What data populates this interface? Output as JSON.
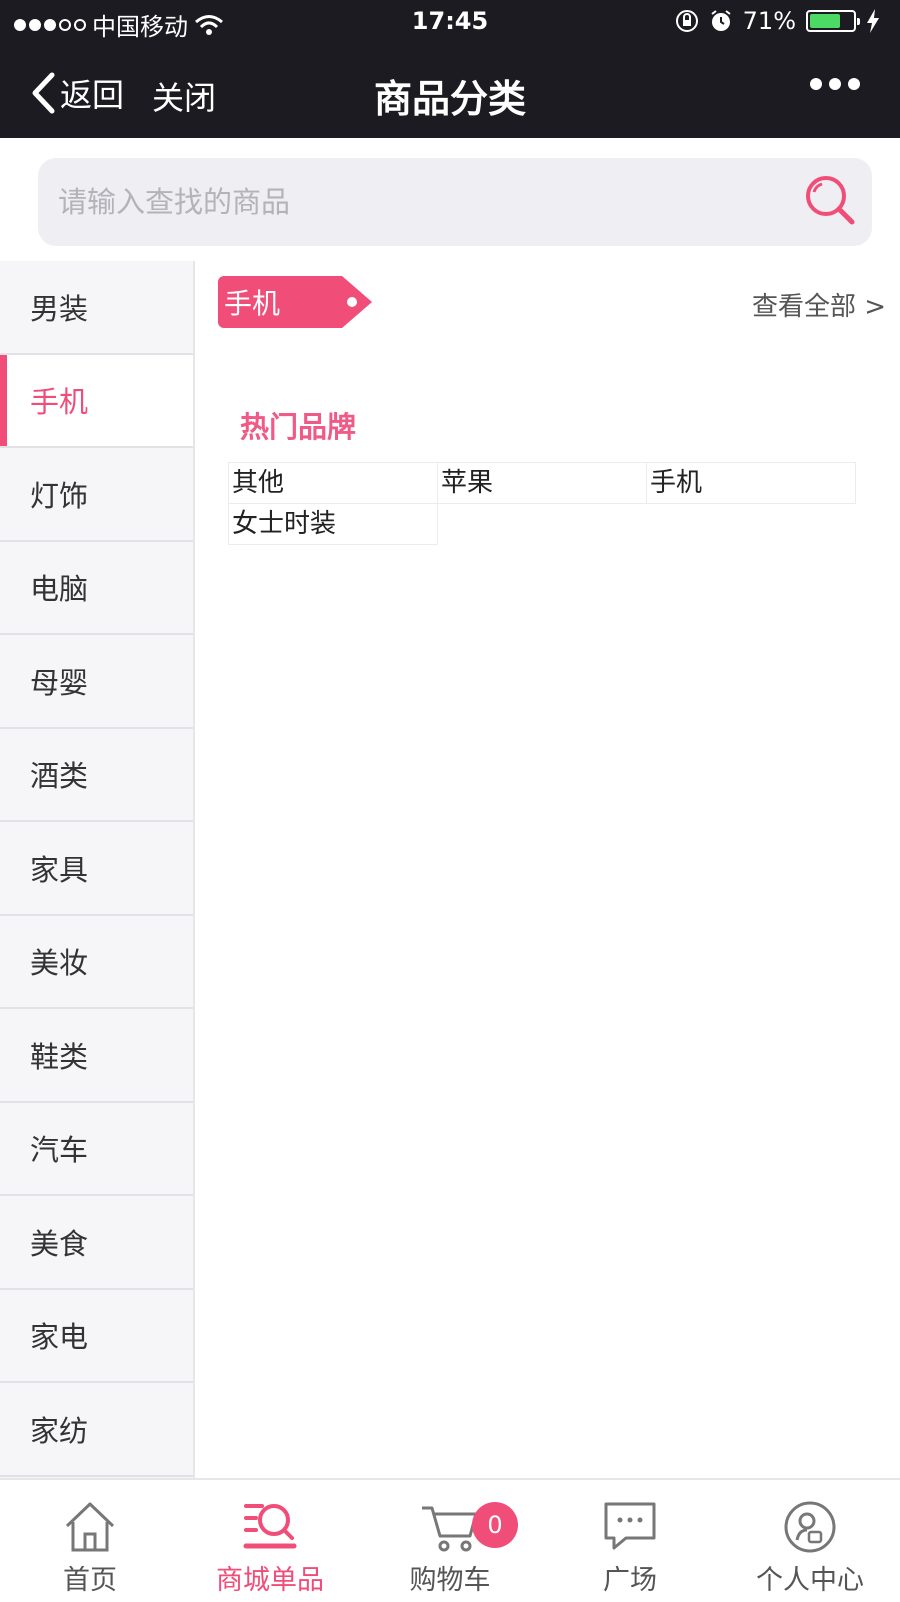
{
  "status_bar": {
    "carrier": "中国移动",
    "time": "17:45",
    "battery": "71%",
    "battery_level": 0.71
  },
  "nav": {
    "back_label": "返回",
    "close_label": "关闭",
    "title": "商品分类"
  },
  "search": {
    "placeholder": "请输入查找的商品",
    "value": ""
  },
  "sidebar": {
    "items": [
      {
        "label": "男装",
        "active": false
      },
      {
        "label": "手机",
        "active": true
      },
      {
        "label": "灯饰",
        "active": false
      },
      {
        "label": "电脑",
        "active": false
      },
      {
        "label": "母婴",
        "active": false
      },
      {
        "label": "酒类",
        "active": false
      },
      {
        "label": "家具",
        "active": false
      },
      {
        "label": "美妆",
        "active": false
      },
      {
        "label": "鞋类",
        "active": false
      },
      {
        "label": "汽车",
        "active": false
      },
      {
        "label": "美食",
        "active": false
      },
      {
        "label": "家电",
        "active": false
      },
      {
        "label": "家纺",
        "active": false
      }
    ]
  },
  "content": {
    "category_tag": "手机",
    "view_all": "查看全部 >",
    "hot_brands_title": "热门品牌",
    "brands": [
      "其他",
      "苹果",
      "手机",
      "女士时装"
    ]
  },
  "tabbar": {
    "tabs": [
      {
        "label": "首页",
        "icon": "home-icon"
      },
      {
        "label": "商城单品",
        "icon": "store-search-icon"
      },
      {
        "label": "购物车",
        "icon": "cart-icon"
      },
      {
        "label": "广场",
        "icon": "chat-bubble-icon"
      },
      {
        "label": "个人中心",
        "icon": "user-circle-icon"
      }
    ],
    "active_index": 1,
    "cart_count": "0"
  },
  "colors": {
    "accent": "#f04d78",
    "topbar": "#1c1b21",
    "sidebar_bg": "#f6f5f8",
    "search_bg": "#efeef3"
  }
}
